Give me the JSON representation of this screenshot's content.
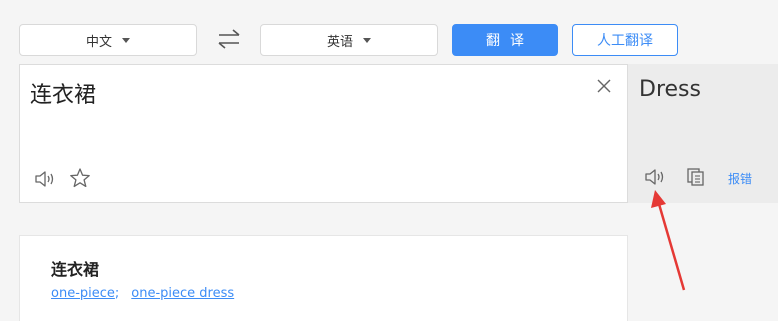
{
  "toolbar": {
    "source_lang": "中文",
    "target_lang": "英语",
    "translate_label": "翻译",
    "human_translate_label": "人工翻译"
  },
  "input": {
    "text": "连衣裙"
  },
  "output": {
    "text": "Dress",
    "report_label": "报错"
  },
  "dictionary": {
    "word": "连衣裙",
    "meanings": [
      "one-piece",
      "one-piece dress"
    ],
    "separator": ";"
  },
  "icons": {
    "swap": "swap-arrows-icon",
    "clear": "close-icon",
    "speaker": "speaker-icon",
    "star": "star-icon",
    "copy": "copy-icon",
    "annotation": "red-arrow-annotation"
  },
  "colors": {
    "accent": "#3c8cf6",
    "annotation": "#e53935"
  }
}
